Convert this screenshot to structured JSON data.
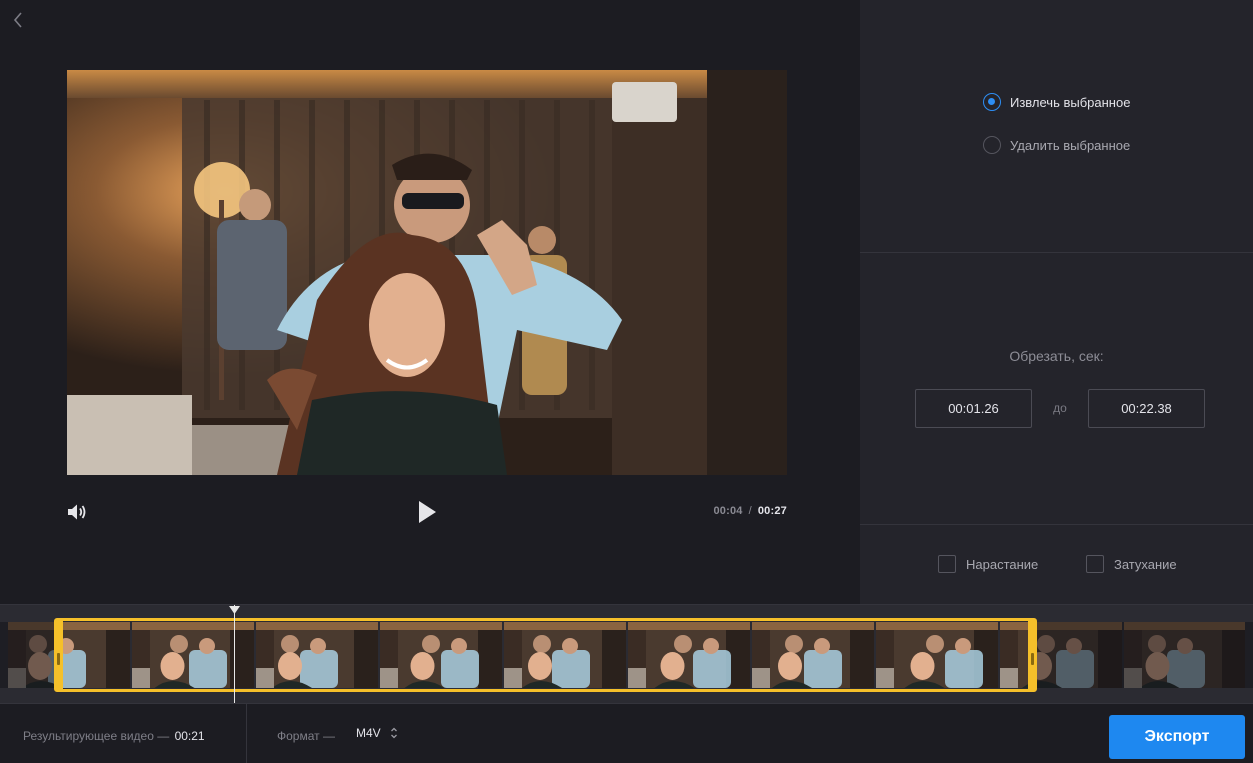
{
  "player": {
    "current_time": "00:04",
    "separator": "/",
    "total_time": "00:27"
  },
  "mode": {
    "options": [
      {
        "label": "Извлечь выбранное",
        "selected": true
      },
      {
        "label": "Удалить выбранное",
        "selected": false
      }
    ]
  },
  "trim": {
    "title": "Обрезать, сек:",
    "start": "00:01.26",
    "to_label": "до",
    "end": "00:22.38"
  },
  "effects": {
    "fade_in": {
      "label": "Нарастание",
      "checked": false
    },
    "fade_out": {
      "label": "Затухание",
      "checked": false
    }
  },
  "timeline": {
    "thumbnail_count": 10,
    "selection_color": "#f5c02a"
  },
  "footer": {
    "result_label": "Результирующее видео —",
    "result_value": "00:21",
    "format_label": "Формат —",
    "format_value": "M4V",
    "export_label": "Экспорт"
  },
  "colors": {
    "accent": "#1e88f0",
    "radio_active": "#2d8ef4",
    "background": "#1c1c22",
    "panel": "#24242b"
  },
  "icons": {
    "back": "chevron-left-icon",
    "volume": "volume-icon",
    "play": "play-icon",
    "format_toggle": "up-down-arrows-icon"
  }
}
